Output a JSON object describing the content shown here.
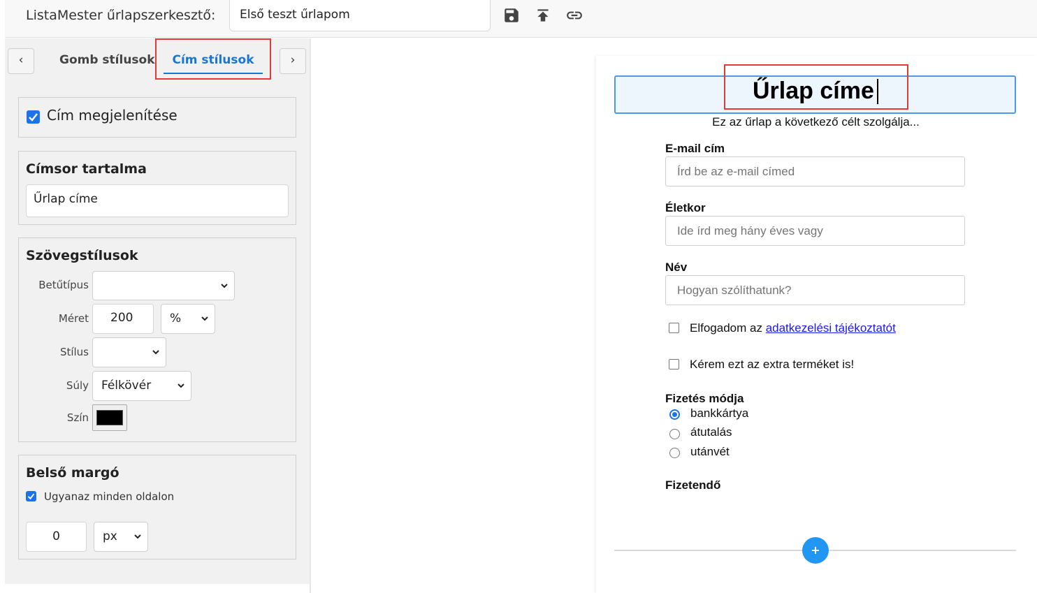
{
  "app": {
    "title": "ListaMester űrlapszerkesztő:",
    "form_name": "Első teszt űrlapom"
  },
  "toolbar": {
    "save_icon": "save-icon",
    "upload_icon": "upload-icon",
    "link_icon": "link-icon"
  },
  "tabs": {
    "prev": "‹",
    "next": "›",
    "items": [
      {
        "label": "Gomb stílusok",
        "active": false
      },
      {
        "label": "Cím stílusok",
        "active": true
      }
    ]
  },
  "panel": {
    "show_title": {
      "label": "Cím megjelenítése",
      "checked": true
    },
    "heading_content": {
      "title": "Címsor tartalma",
      "value": "Űrlap címe"
    },
    "text_styles": {
      "title": "Szövegstílusok",
      "font_label": "Betűtípus",
      "font_value": "",
      "size_label": "Méret",
      "size_value": "200",
      "size_unit": "%",
      "style_label": "Stílus",
      "style_value": "",
      "weight_label": "Súly",
      "weight_value": "Félkövér",
      "color_label": "Szín",
      "color_value": "#000000"
    },
    "padding": {
      "title": "Belső margó",
      "same_all_label": "Ugyanaz minden oldalon",
      "same_all_checked": true,
      "value": "0",
      "unit": "px"
    }
  },
  "preview": {
    "title": "Űrlap címe",
    "description": "Ez az űrlap a következő célt szolgálja...",
    "fields": [
      {
        "label": "E-mail cím",
        "placeholder": "Írd be az e-mail címed"
      },
      {
        "label": "Életkor",
        "placeholder": "Ide írd meg hány éves vagy"
      },
      {
        "label": "Név",
        "placeholder": "Hogyan szólíthatunk?"
      }
    ],
    "consent": {
      "prefix": "Elfogadom az ",
      "link": "adatkezelési tájékoztatót"
    },
    "extra_product": "Kérem ezt az extra terméket is!",
    "payment": {
      "label": "Fizetés módja",
      "options": [
        "bankkártya",
        "átutalás",
        "utánvét"
      ],
      "selected_index": 0
    },
    "payable_label": "Fizetendő",
    "add_button": "+"
  },
  "colors": {
    "accent": "#1976d2",
    "highlight": "#e53935",
    "title_box_border": "#4a9be6",
    "add_button": "#2196f3"
  }
}
